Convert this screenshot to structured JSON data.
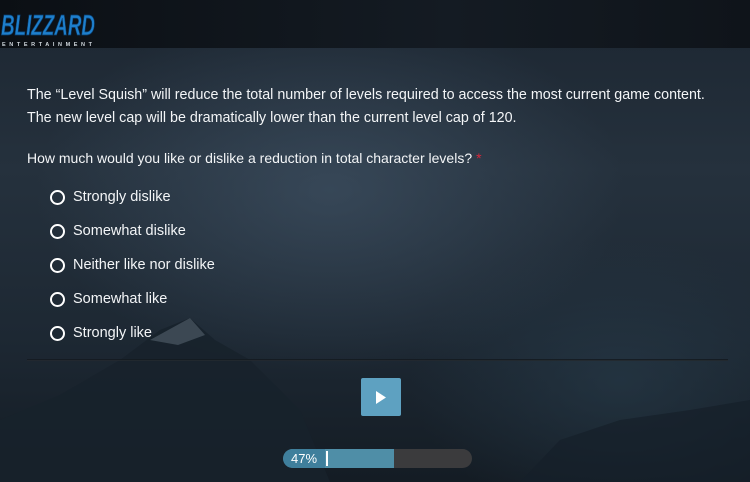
{
  "header": {
    "logo_main": "BLIZZARD",
    "logo_sub": "ENTERTAINMENT",
    "logo_icon": "blizzard-logo"
  },
  "survey": {
    "intro": "The “Level Squish” will reduce the total number of levels required to access the most current game content. The new level cap will be dramatically lower than the current level cap of 120.",
    "question": "How much would you like or dislike a reduction in total character levels?",
    "required_mark": "*",
    "required_color": "#d9263a",
    "options": [
      {
        "label": "Strongly dislike",
        "selected": false
      },
      {
        "label": "Somewhat dislike",
        "selected": false
      },
      {
        "label": "Neither like nor dislike",
        "selected": false
      },
      {
        "label": "Somewhat like",
        "selected": false
      },
      {
        "label": "Strongly like",
        "selected": false
      }
    ]
  },
  "navigation": {
    "next_icon": "play-arrow-icon",
    "accent_color": "#5ea1c1"
  },
  "progress": {
    "label": "47%",
    "value": 0.47
  }
}
